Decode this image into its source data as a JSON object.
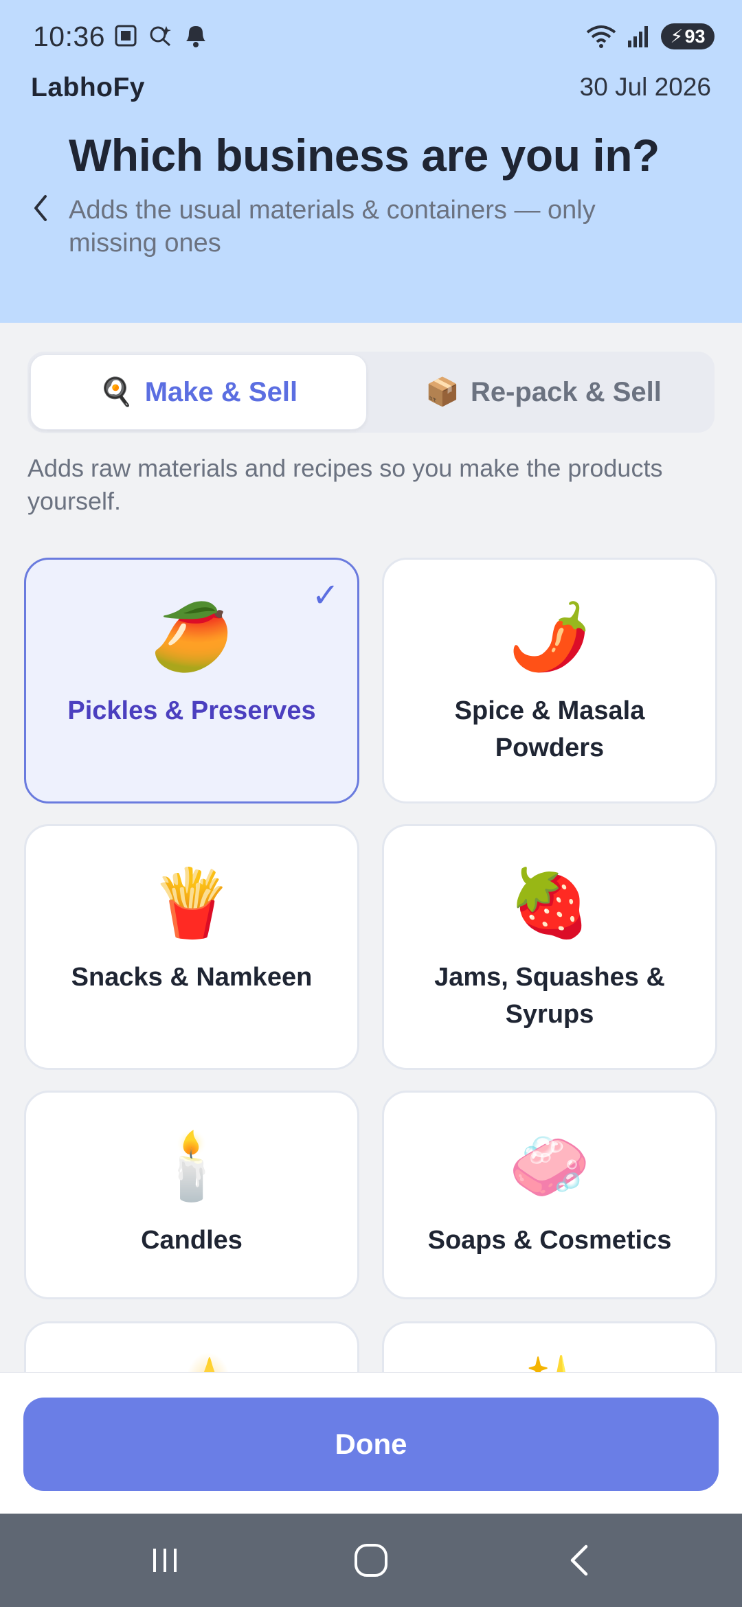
{
  "status_bar": {
    "time": "10:36",
    "battery": "93",
    "icons_left": [
      "screenshot-icon",
      "assistant-icon",
      "notification-bell-icon"
    ],
    "icons_right": [
      "wifi-icon",
      "signal-icon",
      "battery-icon"
    ]
  },
  "header": {
    "app_name": "LabhoFy",
    "date": "30 Jul 2026",
    "title": "Which business are you in?",
    "subtitle": "Adds the usual materials & containers — only missing ones",
    "background_color": "#bfdbfe"
  },
  "tabs": [
    {
      "label": "Make & Sell",
      "icon": "🍳",
      "active": true
    },
    {
      "label": "Re-pack & Sell",
      "icon": "📦",
      "active": false
    }
  ],
  "mode_description": "Adds raw materials and recipes so you make the products yourself.",
  "categories": [
    {
      "label": "Pickles & Preserves",
      "emoji": "🥭",
      "selected": true
    },
    {
      "label": "Spice & Masala Powders",
      "emoji": "🌶️",
      "selected": false
    },
    {
      "label": "Snacks & Namkeen",
      "emoji": "🍟",
      "selected": false
    },
    {
      "label": "Jams, Squashes & Syrups",
      "emoji": "🍓",
      "selected": false
    },
    {
      "label": "Candles",
      "emoji": "🕯️",
      "selected": false
    },
    {
      "label": "Soaps & Cosmetics",
      "emoji": "🧼",
      "selected": false
    },
    {
      "label": "",
      "emoji": "🪔",
      "selected": false
    },
    {
      "label": "",
      "emoji": "✨",
      "selected": false
    }
  ],
  "check_mark": "✓",
  "footer": {
    "done_label": "Done",
    "accent_color": "#6a7ee6"
  },
  "navbar": {
    "icons": [
      "recent-apps-icon",
      "home-icon",
      "back-nav-icon"
    ]
  }
}
